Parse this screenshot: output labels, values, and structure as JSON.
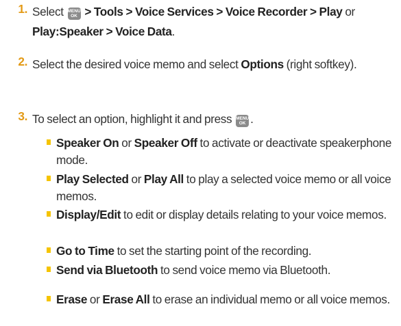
{
  "steps": [
    {
      "number": "1.",
      "parts": [
        {
          "text": "Select ",
          "bold": false
        },
        {
          "key": true
        },
        {
          "text": " > Tools > Voice Services > Voice Recorder > Play",
          "bold": true
        },
        {
          "text": " or ",
          "bold": false
        },
        {
          "text": "Play:Speaker > Voice Data",
          "bold": true
        },
        {
          "text": ".",
          "bold": false
        }
      ]
    },
    {
      "number": "2.",
      "parts": [
        {
          "text": "Select the desired voice memo and select ",
          "bold": false
        },
        {
          "text": "Options",
          "bold": true
        },
        {
          "text": " (right softkey).",
          "bold": false
        }
      ]
    },
    {
      "number": "3.",
      "parts": [
        {
          "text": "To select an option, highlight it and press ",
          "bold": false
        },
        {
          "key": true
        },
        {
          "text": ".",
          "bold": false
        }
      ]
    }
  ],
  "menu_key": {
    "line1": "MENU",
    "line2": "OK"
  },
  "options": [
    [
      {
        "text": "Speaker On",
        "bold": true
      },
      {
        "text": " or ",
        "bold": false
      },
      {
        "text": "Speaker Off",
        "bold": true
      },
      {
        "text": " to activate or deactivate speakerphone mode.",
        "bold": false
      }
    ],
    [
      {
        "text": "Play Selected",
        "bold": true
      },
      {
        "text": " or ",
        "bold": false
      },
      {
        "text": "Play All",
        "bold": true
      },
      {
        "text": " to play a selected voice memo or all voice memos.",
        "bold": false
      }
    ],
    [
      {
        "text": "Display/Edit",
        "bold": true
      },
      {
        "text": " to edit or display details relating to your voice memos.",
        "bold": false
      }
    ],
    [
      {
        "text": "Go to Time",
        "bold": true
      },
      {
        "text": " to set the starting point of the recording.",
        "bold": false
      }
    ],
    [
      {
        "text": "Send via Bluetooth",
        "bold": true
      },
      {
        "text": "  to send voice memo via Bluetooth.",
        "bold": false
      }
    ],
    [
      {
        "text": "Erase",
        "bold": true
      },
      {
        "text": " or ",
        "bold": false
      },
      {
        "text": "Erase All",
        "bold": true
      },
      {
        "text": " to erase an individual memo or all voice memos.",
        "bold": false
      }
    ]
  ]
}
